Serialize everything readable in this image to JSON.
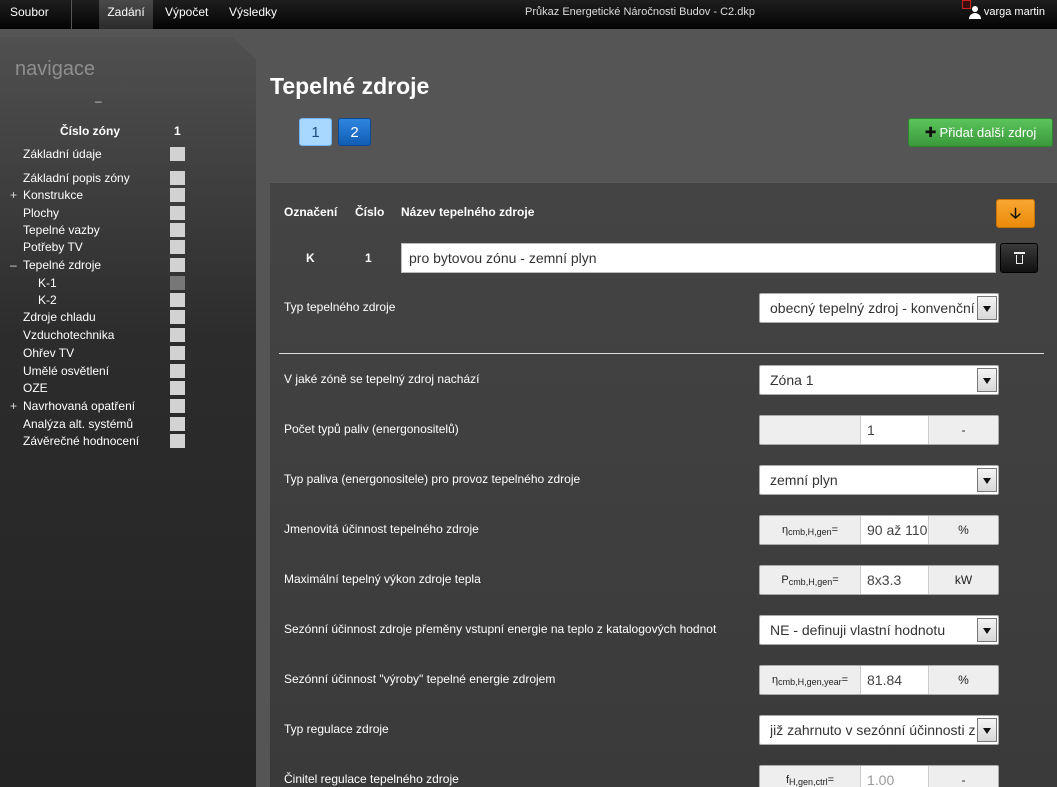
{
  "topbar": {
    "menu": [
      "Soubor",
      "Zadání",
      "Výpočet",
      "Výsledky"
    ],
    "app_title": "Průkaz Energetické Náročnosti Budov - C2.dkp",
    "user": "varga martin"
  },
  "sidebar": {
    "title": "navigace",
    "collapse": "–",
    "zone_label": "Číslo zóny",
    "zone_number": "1",
    "items": [
      {
        "pm": "",
        "label": "Základní údaje"
      },
      {
        "pm": "",
        "label": "Základní popis zóny"
      },
      {
        "pm": "+",
        "label": "Konstrukce"
      },
      {
        "pm": "",
        "label": "Plochy"
      },
      {
        "pm": "",
        "label": "Tepelné vazby"
      },
      {
        "pm": "",
        "label": "Potřeby TV"
      },
      {
        "pm": "–",
        "label": "Tepelné zdroje"
      },
      {
        "pm": "",
        "label": "K-1"
      },
      {
        "pm": "",
        "label": "K-2"
      },
      {
        "pm": "",
        "label": "Zdroje chladu"
      },
      {
        "pm": "",
        "label": "Vzduchotechnika"
      },
      {
        "pm": "",
        "label": "Ohřev TV"
      },
      {
        "pm": "",
        "label": "Umělé osvětlení"
      },
      {
        "pm": "",
        "label": "OZE"
      },
      {
        "pm": "+",
        "label": "Navrhovaná opatření"
      },
      {
        "pm": "",
        "label": "Analýza alt. systémů"
      },
      {
        "pm": "",
        "label": "Závěrečné hodnocení"
      }
    ]
  },
  "main": {
    "title": "Tepelné zdroje",
    "pages": [
      "1",
      "2"
    ],
    "add_button": "Přidat další zdroj",
    "headers": {
      "oznaceni": "Označení",
      "cislo": "Číslo",
      "nazev": "Název tepelného zdroje"
    },
    "source": {
      "oznaceni": "K",
      "cislo": "1",
      "nazev": "pro  bytovou zónu - zemní plyn"
    },
    "fields": [
      {
        "label": "Typ tepelného zdroje",
        "value": "obecný tepelný zdroj - konvenční"
      },
      {
        "label": "V jaké zóně se tepelný zdroj nachází",
        "value": "Zóna 1"
      },
      {
        "label": "Počet typů paliv (energonositelů)",
        "symbol": "",
        "value": "1",
        "unit": "-"
      },
      {
        "label": "Typ paliva (energonositele) pro provoz tepelného zdroje",
        "value": "zemní plyn"
      },
      {
        "label": "Jmenovitá účinnost tepelného zdroje",
        "symbol": "η",
        "symbol_sub": "cmb,H,gen",
        "symbol_suffix": "=",
        "value": "90 až 110",
        "unit": "%"
      },
      {
        "label": "Maximální tepelný výkon zdroje tepla",
        "symbol": "P",
        "symbol_sub": "cmb,H,gen",
        "symbol_suffix": "=",
        "value": "8x3.3",
        "unit": "kW"
      },
      {
        "label": "Sezónní účinnost zdroje přeměny vstupní energie na teplo z katalogových hodnot",
        "value": "NE - definuji vlastní hodnotu"
      },
      {
        "label": "Sezónní účinnost \"výroby\" tepelné energie zdrojem",
        "symbol": "η",
        "symbol_sub": "cmb,H,gen,year",
        "symbol_suffix": "=",
        "value": "81.84",
        "unit": "%"
      },
      {
        "label": "Typ regulace zdroje",
        "value": "již zahrnuto v sezónní účinnosti zdroje"
      },
      {
        "label": "Činitel regulace tepelného zdroje",
        "symbol": "f",
        "symbol_sub": "H,gen,ctrl",
        "symbol_suffix": "=",
        "value": "1.00",
        "unit": "-"
      }
    ]
  }
}
